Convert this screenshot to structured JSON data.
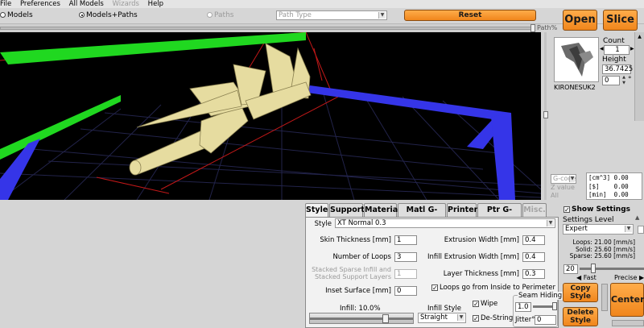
{
  "menu": {
    "items": [
      "File",
      "Preferences",
      "All Models"
    ],
    "disabled_items": [
      "Wizards"
    ],
    "help": "Help"
  },
  "toolbar": {
    "radio_models": "Models",
    "radio_models_paths": "Models+Paths",
    "radio_paths": "Paths",
    "path_type_placeholder": "Path Type",
    "reset_label": "Reset",
    "open_label": "Open",
    "slice_label": "Slice",
    "path_percent_label": "Path%"
  },
  "model": {
    "name": "KIRONESUK2",
    "count_label": "Count",
    "count_value": "1",
    "height_label": "Height",
    "height_value": "36.7425",
    "rotation_value": "0",
    "degree_symbol": "°"
  },
  "gcode": {
    "select_label": "G-code",
    "zvalue_label": "Z value",
    "all_label": "All",
    "stats": [
      {
        "unit": "[cm^3]",
        "value": "0.00"
      },
      {
        "unit": "[$]",
        "value": "0.00"
      },
      {
        "unit": "[min]",
        "value": "0.00"
      }
    ]
  },
  "tabs": [
    {
      "label": "Style",
      "active": true,
      "enabled": true
    },
    {
      "label": "Support",
      "active": false,
      "enabled": true
    },
    {
      "label": "Material",
      "active": false,
      "enabled": true
    },
    {
      "label": "Matl G-code",
      "active": false,
      "enabled": true
    },
    {
      "label": "Printer",
      "active": false,
      "enabled": true
    },
    {
      "label": "Ptr G-code",
      "active": false,
      "enabled": true
    },
    {
      "label": "Misc.",
      "active": false,
      "enabled": false
    }
  ],
  "style": {
    "style_label": "Style",
    "style_value": "XT Normal 0.3",
    "skin_thickness_label": "Skin Thickness [mm]",
    "skin_thickness_value": "1",
    "loops_label": "Number of Loops",
    "loops_value": "3",
    "stacked_label_1": "Stacked Sparse Infill and",
    "stacked_label_2": "Stacked Support Layers",
    "stacked_value": "1",
    "inset_label": "Inset  Surface [mm]",
    "inset_value": "0",
    "extrusion_width_label": "Extrusion Width [mm]",
    "extrusion_width_value": "0.4",
    "infill_extrusion_label": "Infill Extrusion Width [mm]",
    "infill_extrusion_value": "0.4",
    "layer_thickness_label": "Layer Thickness [mm]",
    "layer_thickness_value": "0.3",
    "loops_inside_label": "Loops go from Inside to Perimeter",
    "infill_label": "Infill: 10.0%",
    "infill_percent": 10,
    "infill_style_label": "Infill Style",
    "infill_style_value": "Straight",
    "wipe_label": "Wipe",
    "destring_label": "De-String",
    "seam_label": "Seam Hiding",
    "seam_value": "1.0",
    "jitter_label": "Jitter°",
    "jitter_value": "0"
  },
  "settings": {
    "show_settings_label": "Show Settings",
    "level_label": "Settings Level",
    "level_value": "Expert",
    "loops_speed": "Loops:  21.00 [mm/s]",
    "solid_speed": "Solid:  25.60 [mm/s]",
    "sparse_speed": "Sparse: 25.60 [mm/s]",
    "speed_value": "20",
    "fast_label": "Fast",
    "precise_label": "Precise",
    "copy_style_label_1": "Copy",
    "copy_style_label_2": "Style",
    "delete_style_label_1": "Delete",
    "delete_style_label_2": "Style",
    "center_label": "Center"
  },
  "colors": {
    "accent_orange": "#f0861c",
    "bed_green": "#22dd22",
    "bed_blue": "#3535e8",
    "model_tan": "#e6dca0"
  }
}
